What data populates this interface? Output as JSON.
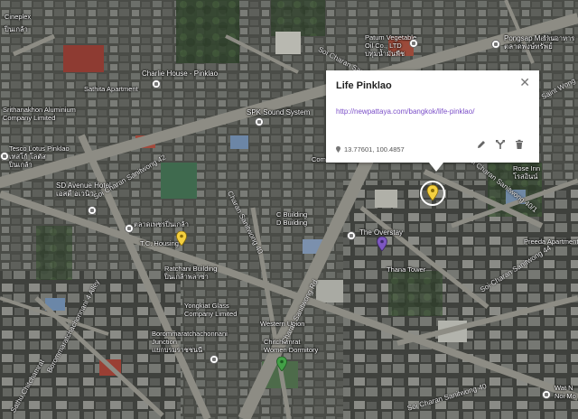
{
  "popup": {
    "title": "Life Pinklao",
    "link": "http://newpattaya.com/bangkok/life-pinklao/",
    "coords": "13.77601, 100.4857",
    "close_icon": "close-icon",
    "tools": [
      "edit-icon",
      "route-icon",
      "delete-icon"
    ]
  },
  "places": [
    {
      "name": "Cineplex",
      "icon": "cinema-icon"
    },
    {
      "name": "ปิ่นเกล้า",
      "icon": "none"
    },
    {
      "name": "Charlie House - Pinklao",
      "icon": "lodging-icon"
    },
    {
      "name": "Sathita Apartment",
      "icon": "none"
    },
    {
      "name": "SPK Sound System",
      "icon": "shop-icon"
    },
    {
      "name": "Patum Vegetable\nOil Co., LTD\nปทุมน้ำมันพืช",
      "icon": "store-icon"
    },
    {
      "name": "Pongsap Market\nตลาดพงษ์ทรัพย์",
      "icon": "market-icon"
    },
    {
      "name": "ร้านอาหาร",
      "icon": "restaurant-icon"
    },
    {
      "name": "Tesco Lotus Pinklao\nเทสโก้ โลตัส\nปิ่นเกล้า",
      "icon": "shopping-icon"
    },
    {
      "name": "Srithanakhon Aluminium\nCompany Limited",
      "icon": "none"
    },
    {
      "name": "SD Avenue Hotel\nเอสดี อเวนิว",
      "icon": "lodging-icon"
    },
    {
      "name": "ตลาดเพชรปิ่นเกล้า",
      "icon": "market-icon"
    },
    {
      "name": "T.C. Housing",
      "icon": "none"
    },
    {
      "name": "Ratchani Building\nปิ่นเกล้าพลาซ่า",
      "icon": "none"
    },
    {
      "name": "Yongkiat Glass\nCompany Limited",
      "icon": "none"
    },
    {
      "name": "Borommaratchachonnani\nJunction\nแยกบรมราชชนนี",
      "icon": "transit-icon"
    },
    {
      "name": "C Building\nD Building",
      "icon": "none"
    },
    {
      "name": "The Overstay",
      "icon": "lodging-icon"
    },
    {
      "name": "Thana Tower",
      "icon": "none"
    },
    {
      "name": "Western Union",
      "icon": "none"
    },
    {
      "name": "Chitchamrat\nWomen Dormitory",
      "icon": "none"
    },
    {
      "name": "Preeda Apartment",
      "icon": "none"
    },
    {
      "name": "Rose Inn\nโรสอินน์",
      "icon": "lodging-icon"
    },
    {
      "name": "Commercial",
      "icon": "none"
    },
    {
      "name": "Wat N\nNoi Mo",
      "icon": "temple-icon"
    }
  ],
  "roads": [
    "Soi Charan Sanitwong 42",
    "Charan Sanitwong Rd",
    "Charan Sanitwong 40",
    "Soi Charan Sanitwong 40",
    "Soi Charan Sanitwong 44",
    "Soi Charan Sanitwong 40/1",
    "Borommaratchachonnani 4 Alley",
    "Soi Charan Sanitwong 32",
    "Sathu Chitchamrat",
    "Saint Wong"
  ],
  "markers": [
    {
      "name": "selected-marker-life-pinklao",
      "color": "#f4d03f"
    },
    {
      "name": "marker-tc-housing",
      "color": "#f4d03f"
    },
    {
      "name": "marker-the-overstay",
      "color": "#7e57c2"
    },
    {
      "name": "marker-chitchamrat",
      "color": "#43a047"
    }
  ]
}
